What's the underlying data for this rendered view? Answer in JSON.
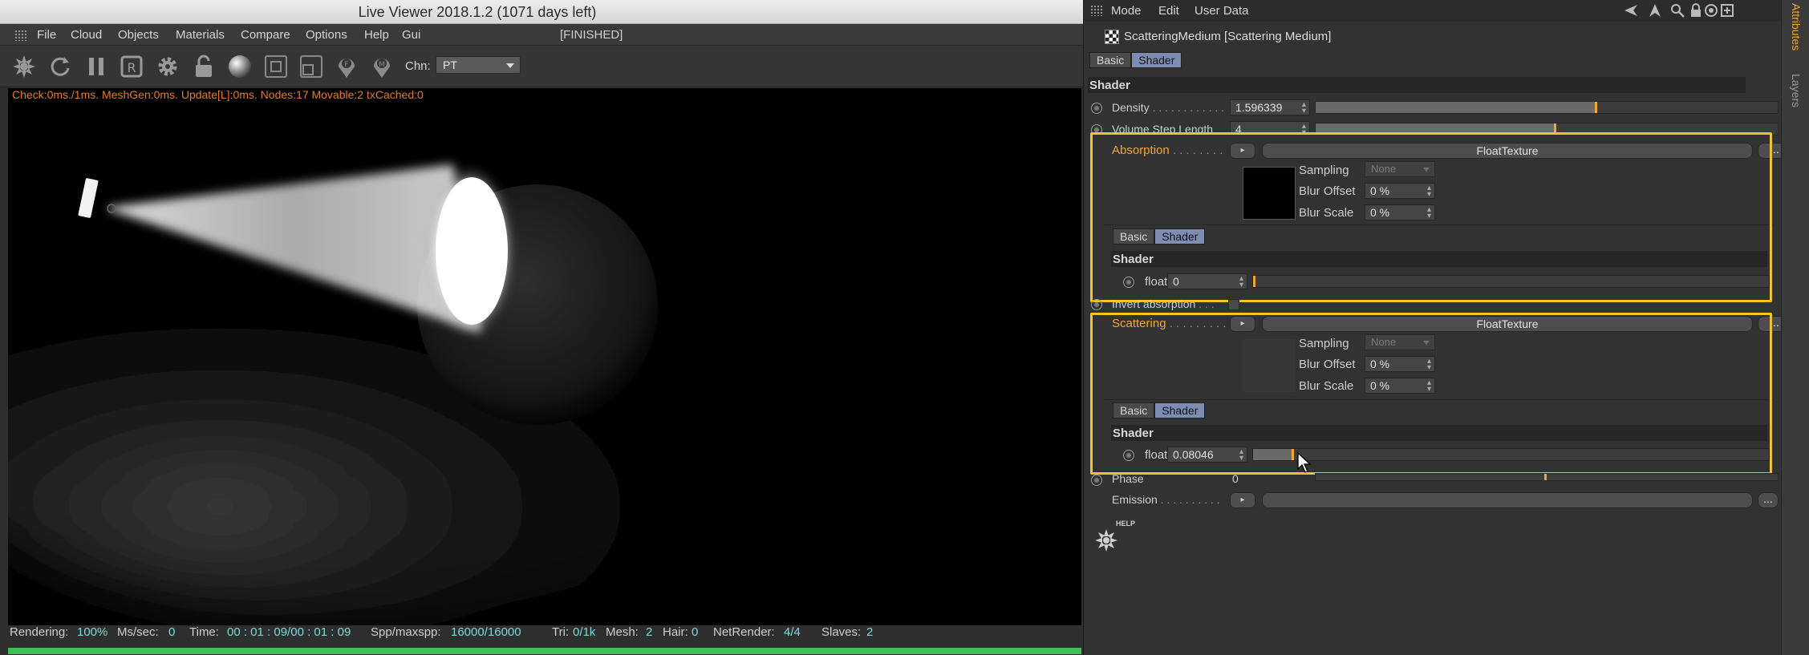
{
  "viewer": {
    "title": "Live Viewer 2018.1.2 (1071 days left)",
    "menu": [
      "File",
      "Cloud",
      "Objects",
      "Materials",
      "Compare",
      "Options",
      "Help",
      "Gui"
    ],
    "state": "[FINISHED]",
    "channel_label": "Chn:",
    "channel_value": "PT",
    "render_stats": "Check:0ms./1ms. MeshGen:0ms. Update[L]:0ms. Nodes:17 Movable:2 txCached:0",
    "toolbar_icons": [
      "octane-icon",
      "refresh-icon",
      "pause-icon",
      "region-icon",
      "settings-icon",
      "lock-icon",
      "material-ball-icon",
      "focus-icon",
      "region-zoom-icon",
      "pin-f-icon",
      "pin-m-icon"
    ],
    "status": {
      "rendering_label": "Rendering:",
      "rendering": "100%",
      "mssec_label": "Ms/sec:",
      "mssec": "0",
      "time_label": "Time:",
      "time": "00 : 01 : 09/00 : 01 : 09",
      "spp_label": "Spp/maxspp:",
      "spp": "16000/16000",
      "tri_label": "Tri:",
      "tri": "0/1k",
      "mesh_label": "Mesh:",
      "mesh": "2",
      "hair_label": "Hair:",
      "hair": "0",
      "netrender_label": "NetRender:",
      "netrender": "4/4",
      "slaves_label": "Slaves:",
      "slaves": "2"
    },
    "progress": 1.0
  },
  "attributes": {
    "menu": [
      "Mode",
      "Edit",
      "User Data"
    ],
    "object_name": "ScatteringMedium [Scattering Medium]",
    "tabs": [
      "Basic",
      "Shader"
    ],
    "group_title": "Shader",
    "density_label": "Density",
    "density_value": "1.596339",
    "density_fraction": 0.61,
    "volume_step_label": "Volume Step Length",
    "volume_step_value": "4",
    "volume_step_fraction": 0.52,
    "absorption": {
      "label": "Absorption",
      "texture": "FloatTexture",
      "dots": "...",
      "sampling_label": "Sampling",
      "sampling_value": "None",
      "blur_offset_label": "Blur Offset",
      "blur_offset_value": "0 %",
      "blur_scale_label": "Blur Scale",
      "blur_scale_value": "0 %",
      "tabs": [
        "Basic",
        "Shader"
      ],
      "shader_title": "Shader",
      "float_label": "float",
      "float_value": "0",
      "float_fraction": 0.0
    },
    "invert_absorption_label": "Invert absorption",
    "scattering": {
      "label": "Scattering",
      "texture": "FloatTexture",
      "dots": "...",
      "sampling_label": "Sampling",
      "sampling_value": "None",
      "blur_offset_label": "Blur Offset",
      "blur_offset_value": "0 %",
      "blur_scale_label": "Blur Scale",
      "blur_scale_value": "0 %",
      "tabs": [
        "Basic",
        "Shader"
      ],
      "shader_title": "Shader",
      "float_label": "float",
      "float_value": "0.08046",
      "float_fraction": 0.08
    },
    "phase_label": "Phase",
    "phase_value": "0",
    "phase_fraction": 0.5,
    "emission_label": "Emission",
    "emission_dots": "...",
    "help_label": "HELP",
    "side_tabs": [
      "Attributes",
      "Layers"
    ],
    "accent_color": "#f0c232",
    "orange_color": "#f2a72a"
  }
}
